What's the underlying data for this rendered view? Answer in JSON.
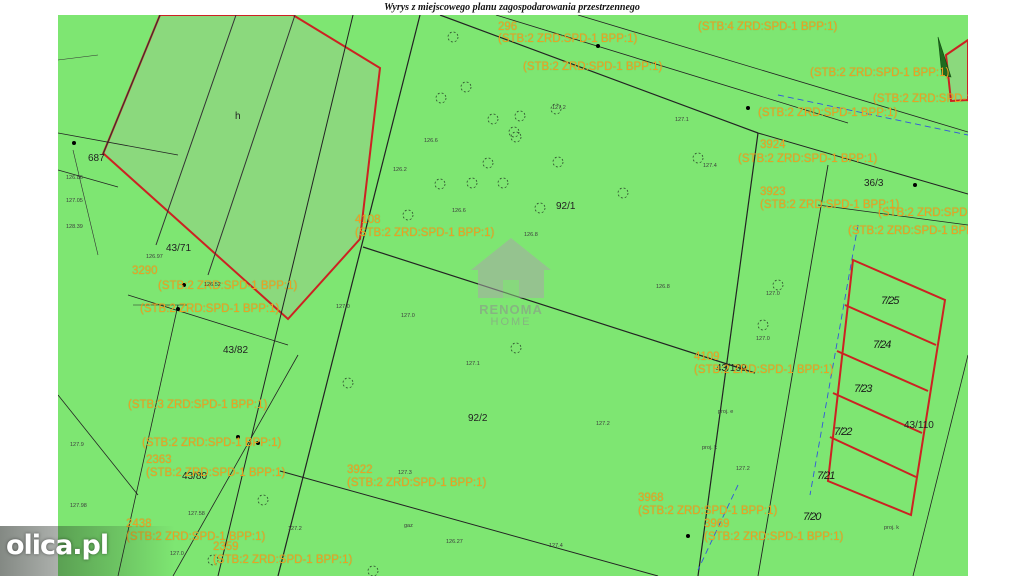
{
  "header": {
    "title": "Wyrys z miejscowego planu zagospodarowania przestrzennego"
  },
  "colors": {
    "zone_fill": "#7ee672",
    "boundary": "#2a2a2a",
    "red_outline": "#cc2222",
    "annotation": "#f0a020"
  },
  "parcels": {
    "p92_1": "92/1",
    "p92_2": "92/2",
    "p43_109": "43/109",
    "p43_110": "43/110",
    "p43_71": "43/71",
    "p43_82": "43/82",
    "p43_80": "43/80",
    "p36_3": "36/3",
    "p687": "687",
    "ph": "h"
  },
  "plots": [
    "7/25",
    "7/24",
    "7/23",
    "7/22",
    "7/21",
    "7/20"
  ],
  "annotations": {
    "a4108_num": "4108",
    "a4108_code": "(STB:2 ZRD:SPD-1 BPP:1)",
    "a4109_num": "4109",
    "a4109_code": "(STB:2 ZRD:SPD-1 BPP:1)",
    "a3922_num": "3922",
    "a3922_code": "(STB:2 ZRD:SPD-1 BPP:1)",
    "a3968_num": "3968",
    "a3968_code": "(STB:2 ZRD:SPD-1 BPP:1)",
    "a3969_num": "3969",
    "a3969_code": "(STB:2 ZRD:SPD-1 BPP:1)",
    "a2363_num": "2363",
    "a2363_code": "(STB:2 ZRD:SPD-1 BPP:1)",
    "a2438_num": "2438",
    "a2438_code": "(STB:2 ZRD:SPD-1 BPP:1)",
    "a2359_num": "2359",
    "a2359_code": "(STB:2 ZRD:SPD-1 BPP:1)",
    "a3290_num": "3290",
    "a3290_code": "(STB:2 ZRD:SPD-1 BPP:1)",
    "a3923_num": "3923",
    "a3923_code": "(STB:2 ZRD:SPD-1 BPP:1)",
    "a3924_num": "3924",
    "a3924_code": "(STB:2 ZRD:SPD-1 BPP:1)",
    "a2490_code": "(STB:3 ZRD:SPD-1 BPP:1)",
    "a296_num": "296",
    "a296_code": "(STB:2 ZRD:SPD-1 BPP:1)",
    "a2393_code": "(STB:2 ZRD:SPD-1 BPP:1)",
    "a_top_right_code": "(STB:4 ZRD:SPD-1 BPP:1)",
    "a_right1_code": "(STB:2 ZRD:SPD-1 BPP:1)",
    "a_right2_code": "(STB:2 ZRD:SPD-1 BPP:1)",
    "a_right3_code": "(STB:2 ZRD:SPD-1 BPP:1)",
    "a3925_num": "3925",
    "a3925_code": "(STB:2 ZRD:SPD-1 BPP:1)"
  },
  "elevations": {
    "e1": "127.3",
    "e2": "126.6",
    "e3": "126.8",
    "e4": "127.0",
    "e5": "127.1",
    "e6": "127.2",
    "e7": "127.4",
    "e8": "126.27",
    "e9": "127.2",
    "e10": "126.8",
    "e11": "127.0",
    "e12": "127.2",
    "e13": "127.0",
    "e14": "126.6",
    "e15": "127.0",
    "e16": "127.9",
    "e17": "127.05",
    "e18": "126.52",
    "e19": "127.1",
    "e20": "127.58",
    "e21": "127.4",
    "e22": "126.2",
    "e23": "127.2",
    "e24": "127.0",
    "e25": "126.86",
    "e26": "127.98",
    "e27": "128.39",
    "e28": "126.97"
  },
  "misc_labels": {
    "proj_k": "proj. k",
    "proj_e": "proj. e",
    "gaz": "gaz"
  },
  "watermark": {
    "line1": "RENOMA",
    "line2": "HOME"
  },
  "source_watermark": {
    "text": "olica.pl"
  }
}
